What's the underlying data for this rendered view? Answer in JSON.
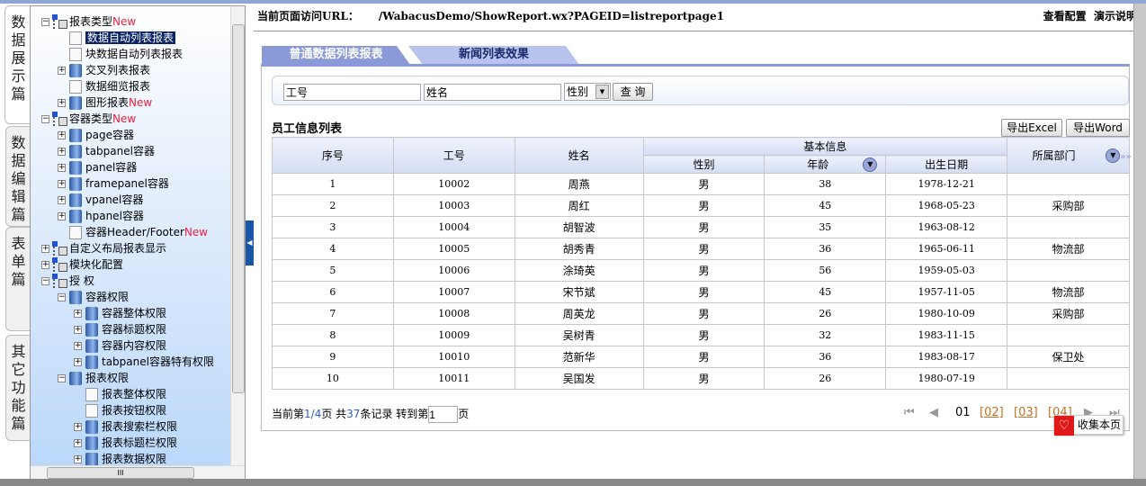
{
  "side_tabs": [
    "数据展示篇",
    "数据编辑篇",
    "表单篇",
    "其它功能篇"
  ],
  "tree": [
    {
      "label": "报表类型",
      "new": "New",
      "level": 0,
      "toggle": "-",
      "icon": "group"
    },
    {
      "label": "数据自动列表报表",
      "level": 1,
      "icon": "page",
      "selected": true
    },
    {
      "label": "块数据自动列表报表",
      "level": 1,
      "icon": "page"
    },
    {
      "label": "交叉列表报表",
      "level": 1,
      "toggle": "+",
      "icon": "book"
    },
    {
      "label": "数据细览报表",
      "level": 1,
      "icon": "page"
    },
    {
      "label": "图形报表",
      "new": "New",
      "level": 1,
      "toggle": "+",
      "icon": "book"
    },
    {
      "label": "容器类型",
      "new": "New",
      "level": 0,
      "toggle": "-",
      "icon": "group"
    },
    {
      "label": "page容器",
      "level": 1,
      "toggle": "+",
      "icon": "book"
    },
    {
      "label": "tabpanel容器",
      "level": 1,
      "toggle": "+",
      "icon": "book"
    },
    {
      "label": "panel容器",
      "level": 1,
      "toggle": "+",
      "icon": "book"
    },
    {
      "label": "framepanel容器",
      "level": 1,
      "toggle": "+",
      "icon": "book"
    },
    {
      "label": "vpanel容器",
      "level": 1,
      "toggle": "+",
      "icon": "book"
    },
    {
      "label": "hpanel容器",
      "level": 1,
      "toggle": "+",
      "icon": "book"
    },
    {
      "label": "容器Header/Footer",
      "new": "New",
      "level": 1,
      "icon": "page"
    },
    {
      "label": "自定义布局报表显示",
      "level": 0,
      "toggle": "+",
      "icon": "group"
    },
    {
      "label": "模块化配置",
      "level": 0,
      "toggle": "+",
      "icon": "group"
    },
    {
      "label": "授  权",
      "level": 0,
      "toggle": "-",
      "icon": "group"
    },
    {
      "label": "容器权限",
      "level": 1,
      "toggle": "-",
      "icon": "book"
    },
    {
      "label": "容器整体权限",
      "level": 2,
      "toggle": "+",
      "icon": "book"
    },
    {
      "label": "容器标题权限",
      "level": 2,
      "toggle": "+",
      "icon": "book"
    },
    {
      "label": "容器内容权限",
      "level": 2,
      "toggle": "+",
      "icon": "book"
    },
    {
      "label": "tabpanel容器特有权限",
      "level": 2,
      "toggle": "+",
      "icon": "book"
    },
    {
      "label": "报表权限",
      "level": 1,
      "toggle": "-",
      "icon": "book"
    },
    {
      "label": "报表整体权限",
      "level": 2,
      "icon": "page"
    },
    {
      "label": "报表按钮权限",
      "level": 2,
      "icon": "page"
    },
    {
      "label": "报表搜索栏权限",
      "level": 2,
      "toggle": "+",
      "icon": "book"
    },
    {
      "label": "报表标题栏权限",
      "level": 2,
      "toggle": "+",
      "icon": "book"
    },
    {
      "label": "报表数据权限",
      "level": 2,
      "toggle": "+",
      "icon": "book"
    }
  ],
  "header": {
    "label": "当前页面访问URL：",
    "url": "/WabacusDemo/ShowReport.wx?PAGEID=listreportpage1",
    "view_config": "查看配置",
    "demo_desc": "演示说明"
  },
  "tabs": [
    "普通数据列表报表",
    "新闻列表效果"
  ],
  "search": {
    "emp_no": "工号",
    "name": "姓名",
    "gender": "性别",
    "query": "查 询"
  },
  "report": {
    "title": "员工信息列表",
    "export_excel": "导出Excel",
    "export_word": "导出Word",
    "headers": {
      "seq": "序号",
      "emp_no": "工号",
      "name": "姓名",
      "basic": "基本信息",
      "gender": "性别",
      "age": "年龄",
      "birth": "出生日期",
      "dept": "所属部门"
    },
    "rows": [
      [
        "1",
        "10002",
        "周燕",
        "男",
        "38",
        "1978-12-21",
        ""
      ],
      [
        "2",
        "10003",
        "周红",
        "男",
        "45",
        "1968-05-23",
        "采购部"
      ],
      [
        "3",
        "10004",
        "胡智波",
        "男",
        "35",
        "1963-08-12",
        ""
      ],
      [
        "4",
        "10005",
        "胡秀青",
        "男",
        "36",
        "1965-06-11",
        "物流部"
      ],
      [
        "5",
        "10006",
        "涂琦英",
        "男",
        "56",
        "1959-05-03",
        ""
      ],
      [
        "6",
        "10007",
        "宋节斌",
        "男",
        "45",
        "1957-11-05",
        "物流部"
      ],
      [
        "7",
        "10008",
        "周英龙",
        "男",
        "26",
        "1980-10-09",
        "采购部"
      ],
      [
        "8",
        "10009",
        "吴树青",
        "男",
        "32",
        "1983-11-15",
        ""
      ],
      [
        "9",
        "10010",
        "范新华",
        "男",
        "36",
        "1983-08-17",
        "保卫处"
      ],
      [
        "10",
        "10011",
        "吴国发",
        "男",
        "26",
        "1980-07-19",
        ""
      ]
    ]
  },
  "footer": {
    "p1": "当前第",
    "page": "1/4",
    "p2": "页 共",
    "total": "37",
    "p3": "条记录 转到第",
    "goto": "1",
    "p4": "页"
  },
  "pager": {
    "current": "01",
    "pages": [
      "[02]",
      "[03]",
      "[04]"
    ]
  },
  "favorite": "收集本页"
}
